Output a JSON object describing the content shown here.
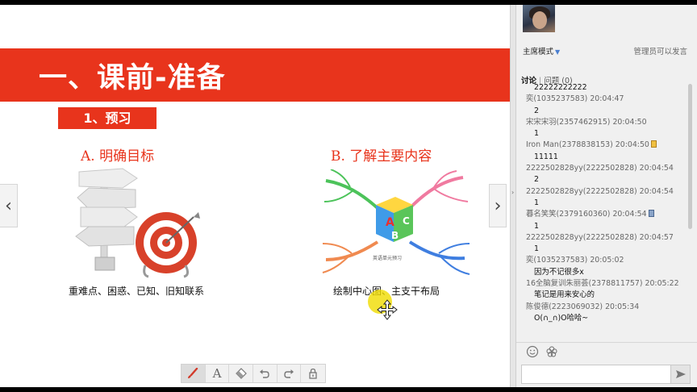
{
  "slide": {
    "title": "一、课前-准备",
    "subheading": "1、预习",
    "section_a": {
      "heading": "A. 明确目标",
      "caption": "重难点、困惑、已知、旧知联系"
    },
    "section_b": {
      "heading": "B. 了解主要内容",
      "caption": "绘制中心图、主支干布局"
    },
    "mindmap_center_letters": [
      "A",
      "B",
      "C"
    ],
    "mindmap_center_text": "英语单元预习"
  },
  "panel": {
    "mode": "主席模式",
    "mode_note": "管理员可以发言",
    "tab_discussion": "讨论",
    "tab_questions": "问题 (0)",
    "messages": [
      {
        "text": "22222222222",
        "type": "msg"
      },
      {
        "text": "奕(1035237583) 20:04:47",
        "type": "meta"
      },
      {
        "text": "2",
        "type": "msg"
      },
      {
        "text": "宋宋宋羽(2357462915) 20:04:50",
        "type": "meta"
      },
      {
        "text": "1",
        "type": "msg"
      },
      {
        "text": "Iron Man(2378838153) 20:04:50",
        "type": "meta",
        "badge": "gold"
      },
      {
        "text": "11111",
        "type": "msg"
      },
      {
        "text": "2222502828yy(2222502828) 20:04:54",
        "type": "meta"
      },
      {
        "text": "2",
        "type": "msg"
      },
      {
        "text": "2222502828yy(2222502828) 20:04:54",
        "type": "meta"
      },
      {
        "text": "1",
        "type": "msg"
      },
      {
        "text": "暮名笑笑(2379160360) 20:04:54",
        "type": "meta",
        "badge": "phone"
      },
      {
        "text": "1",
        "type": "msg"
      },
      {
        "text": "2222502828yy(2222502828) 20:04:57",
        "type": "meta"
      },
      {
        "text": "1",
        "type": "msg"
      },
      {
        "text": "奕(1035237583) 20:05:02",
        "type": "meta"
      },
      {
        "text": "因为不记很多x",
        "type": "msg"
      },
      {
        "text": "16全脑复训朱丽荟(2378811757) 20:05:22",
        "type": "meta"
      },
      {
        "text": "笔记是用来安心的",
        "type": "msg"
      },
      {
        "text": "陈俊德(2223069032) 20:05:34",
        "type": "meta"
      },
      {
        "text": "O(∩_∩)O哈哈~",
        "type": "msg"
      }
    ],
    "input_value": ""
  },
  "colors": {
    "accent_red": "#e8341c",
    "panel_bg": "#f0f0f0"
  },
  "icons": {
    "toolbar": [
      "brush-icon",
      "text-icon",
      "eraser-icon",
      "undo-icon",
      "redo-icon",
      "lock-icon"
    ],
    "panel": [
      "emoji-icon",
      "flower-icon",
      "send-icon"
    ]
  }
}
